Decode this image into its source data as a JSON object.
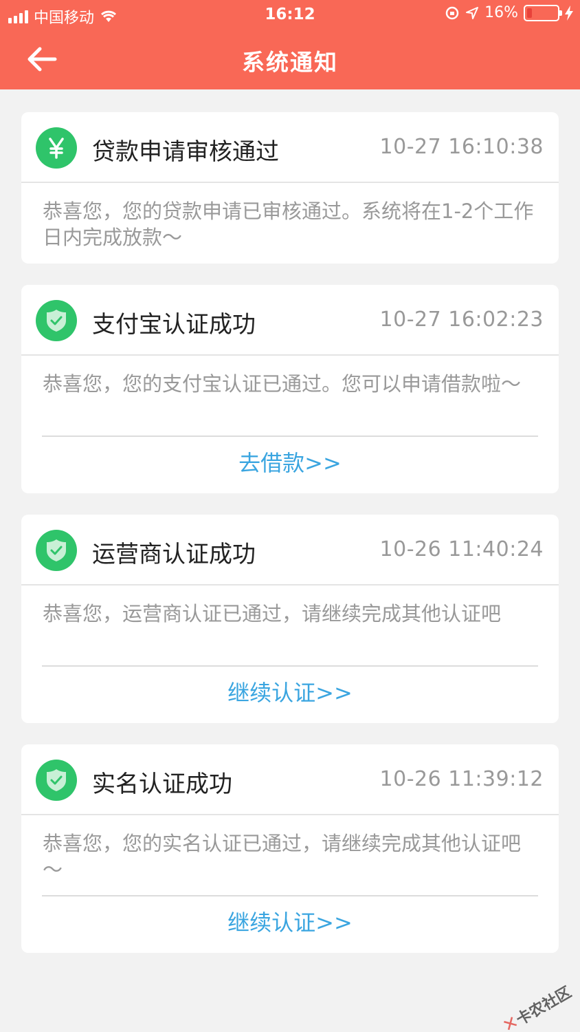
{
  "status_bar": {
    "carrier": "中国移动",
    "time": "16:12",
    "battery_percent": "16%",
    "battery_level": 0.16
  },
  "navbar": {
    "title": "系统通知",
    "back_icon": "arrow-left-icon"
  },
  "notifications": [
    {
      "icon": "yen-icon",
      "title": "贷款申请审核通过",
      "time": "10-27 16:10:38",
      "body": "恭喜您，您的贷款申请已审核通过。系统将在1-2个工作日内完成放款～",
      "action": ""
    },
    {
      "icon": "shield-check-icon",
      "title": "支付宝认证成功",
      "time": "10-27 16:02:23",
      "body": "恭喜您，您的支付宝认证已通过。您可以申请借款啦～",
      "action": "去借款>>"
    },
    {
      "icon": "shield-check-icon",
      "title": "运营商认证成功",
      "time": "10-26 11:40:24",
      "body": "恭喜您，运营商认证已通过，请继续完成其他认证吧",
      "action": "继续认证>>"
    },
    {
      "icon": "shield-check-icon",
      "title": "实名认证成功",
      "time": "10-26 11:39:12",
      "body": "恭喜您，您的实名认证已通过，请继续完成其他认证吧～",
      "action": "继续认证>>"
    }
  ],
  "watermark": "卡农社区",
  "colors": {
    "header": "#f96856",
    "icon_green": "#2fc46a",
    "link_blue": "#3aa5e0"
  }
}
